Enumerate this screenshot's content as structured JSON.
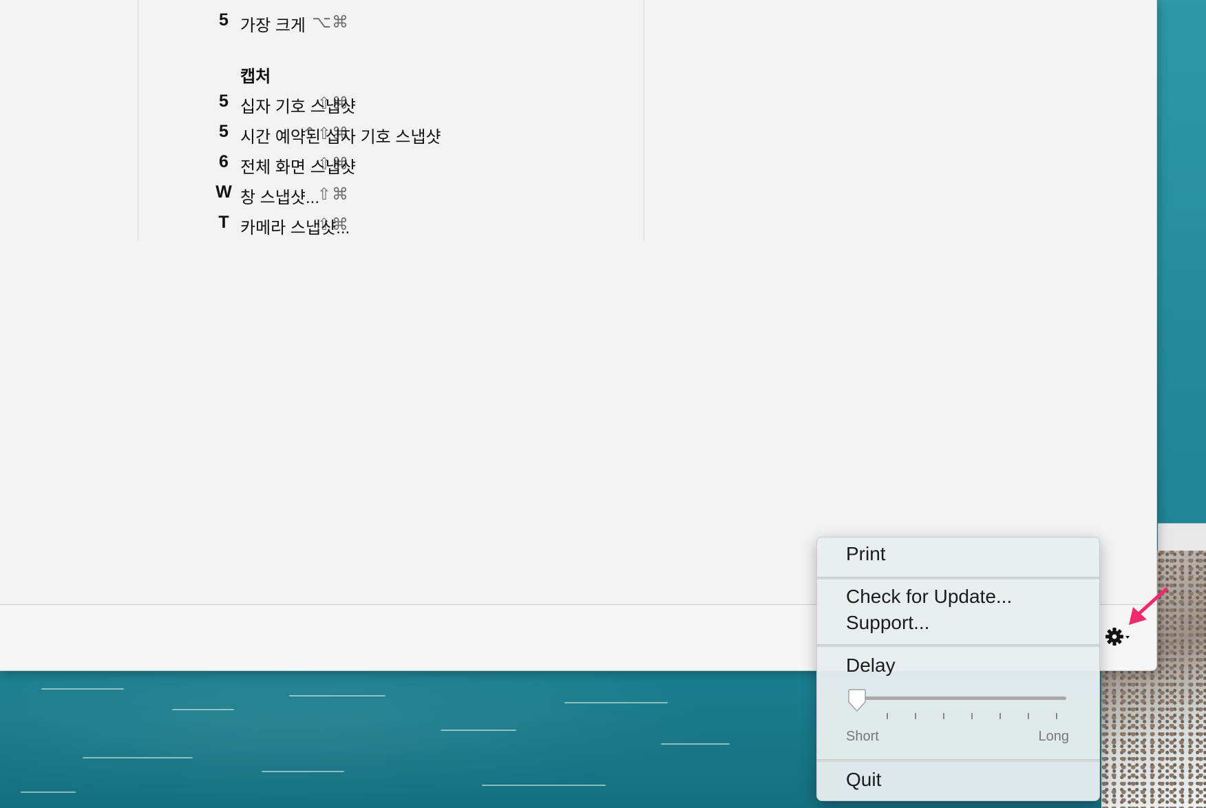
{
  "shortcuts": [
    {
      "keys": "⌥⌘",
      "key": "5",
      "label": "가장 크게"
    },
    {
      "section": "캡처"
    },
    {
      "keys": "⇧⌘",
      "key": "5",
      "label": "십자 기호 스냅샷"
    },
    {
      "keys": "^⇧⌘",
      "key": "5",
      "label": "시간 예약된 십자 기호 스냅샷"
    },
    {
      "keys": "⇧⌘",
      "key": "6",
      "label": "전체 화면 스냅샷"
    },
    {
      "keys": "⇧⌘",
      "key": "W",
      "label": "창 스냅샷..."
    },
    {
      "keys": "⇧⌘",
      "key": "T",
      "label": "카메라 스냅샷..."
    }
  ],
  "menu": {
    "print": "Print",
    "check_update": "Check for Update...",
    "support": "Support...",
    "delay_label": "Delay",
    "delay": {
      "min_label": "Short",
      "max_label": "Long",
      "value": 0.0,
      "ticks": 8
    },
    "quit": "Quit"
  },
  "icons": {
    "gear": "gear-icon",
    "annotation": "pink-arrow-icon"
  },
  "colors": {
    "annotation_arrow": "#f02a6b",
    "menu_bg": "#e8eeef"
  }
}
